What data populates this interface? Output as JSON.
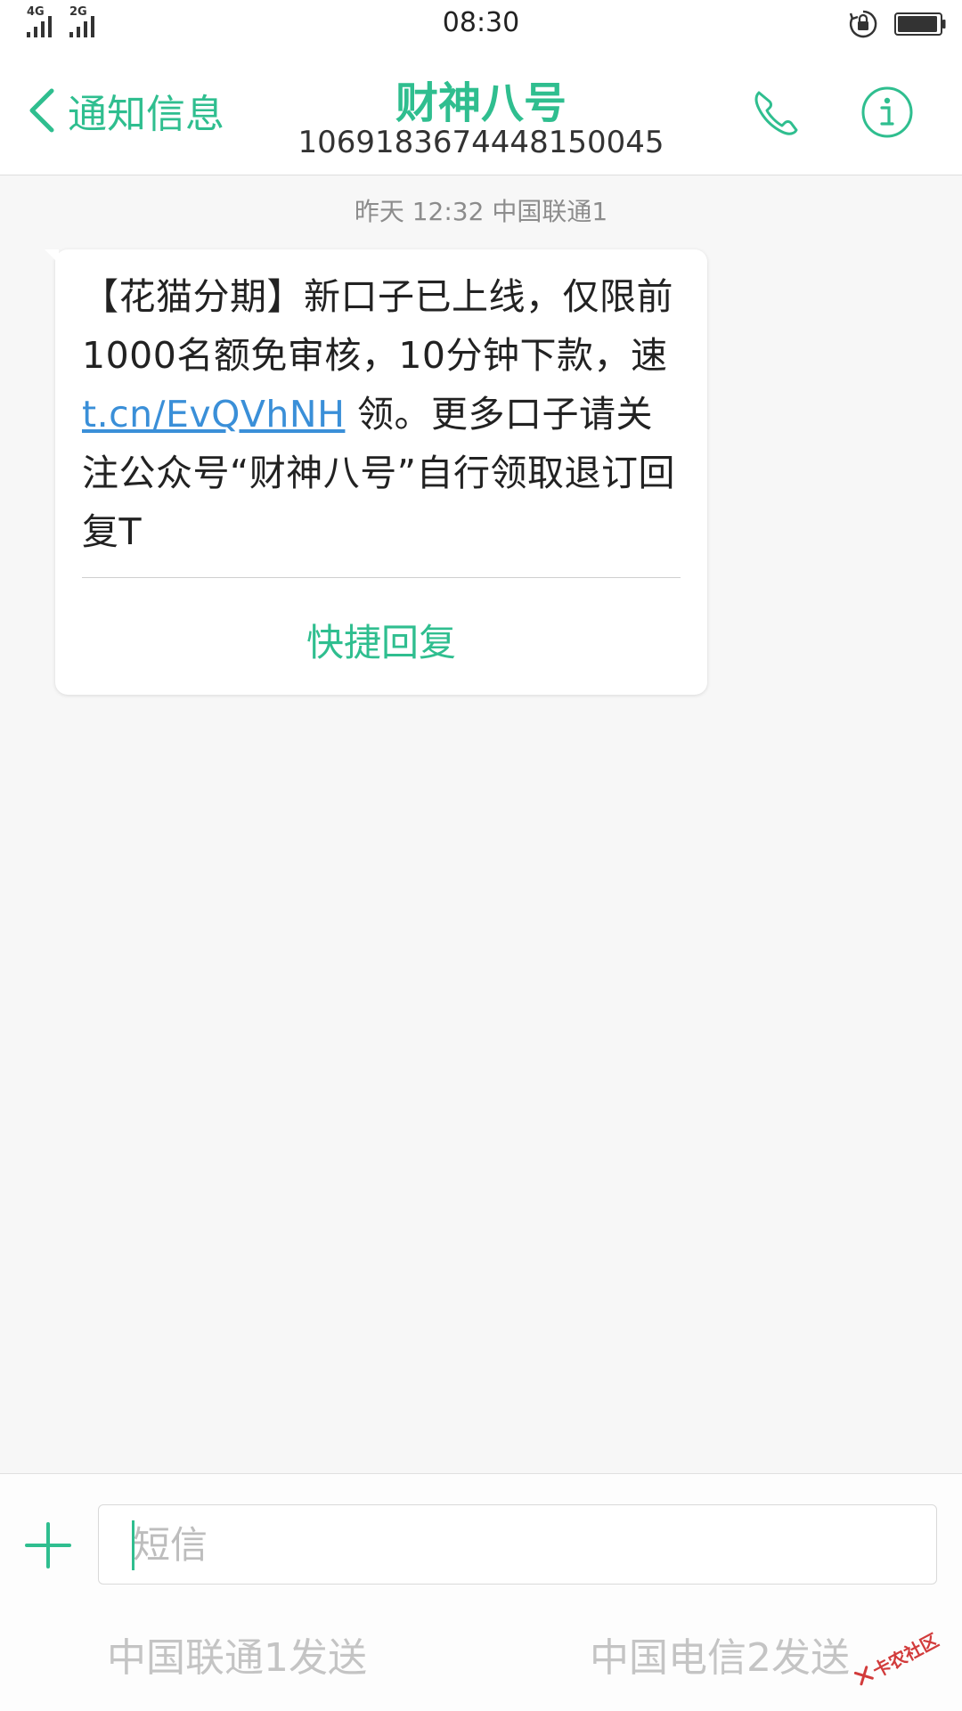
{
  "status_bar": {
    "sim1_network": "4G",
    "sim2_network": "2G",
    "time": "08:30",
    "icons": [
      "signal-icon",
      "rotation-lock-icon",
      "battery-icon"
    ]
  },
  "header": {
    "back_label": "通知信息",
    "contact_name": "财神八号",
    "contact_number": "1069183674448150045",
    "icons": [
      "chevron-left-icon",
      "phone-icon",
      "info-icon"
    ],
    "accent_color": "#2fbe8f"
  },
  "conversation": {
    "timestamp": "昨天 12:32  中国联通1",
    "message": {
      "text_before_link": "【花猫分期】新口子已上线，仅限前1000名额免审核，10分钟下款，速 ",
      "link": "t.cn/EvQVhNH",
      "text_after_link": " 领。更多口子请关注公众号“财神八号”自行领取退订回复T",
      "link_color": "#3a8fd8"
    },
    "quick_reply_label": "快捷回复"
  },
  "compose": {
    "input_placeholder": "短信",
    "input_value": "",
    "send_sim1_label": "中国联通1发送",
    "send_sim2_label": "中国电信2发送",
    "icons": [
      "plus-icon"
    ]
  },
  "watermark": {
    "text": "卡农社区"
  }
}
